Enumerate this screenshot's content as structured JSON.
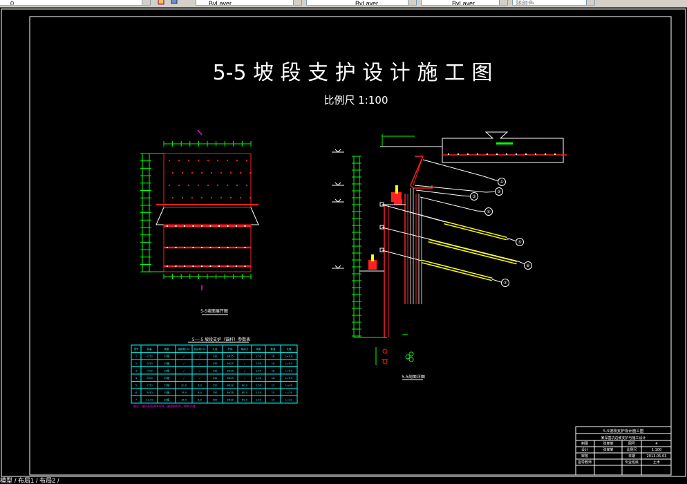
{
  "toolbar": {
    "layer_value": "0",
    "color_value": "ByLayer",
    "linetype_value": "ByLayer",
    "lineweight_value": "ByLayer",
    "plotstyle_value": "随颜色"
  },
  "drawing": {
    "title": "5-5 坡 段 支 护 设 计 施 工 图",
    "scale": "比例尺 1:100",
    "elevation_view_label": "5-5坡面展开图",
    "section_view_label": "5-5剖面详图",
    "table_title": "5----5 坡段支护（锚杆）参数表",
    "table_note": "备注：锚杆采用HRB400，锚固体M30，倾角15度。",
    "callouts": [
      "①",
      "②",
      "③",
      "④",
      "⑤",
      "⑥",
      "⑦"
    ],
    "anchor_table": {
      "headers": [
        "排号",
        "标高",
        "角度",
        "锚固段(m)",
        "自由段(m)",
        "孔径",
        "杆体",
        "轴向力",
        "间距",
        "数量",
        "长度"
      ],
      "rows": [
        [
          "1",
          "-2.50",
          "15度",
          "/",
          "/",
          "130",
          "3Φ25",
          "/",
          "1.50",
          "18",
          "L=9.0"
        ],
        [
          "2",
          "-3.50",
          "15度",
          "/",
          "/",
          "130",
          "3Φ25",
          "/",
          "1.50",
          "18",
          "L=9.0"
        ],
        [
          "3",
          "-4.00",
          "15度",
          "/",
          "/",
          "130",
          "3Φ25",
          "/",
          "1.50",
          "18",
          "L=9.0"
        ],
        [
          "4",
          "-5.00",
          "15度",
          "/",
          "/",
          "130",
          "3Φ25",
          "/",
          "1.50",
          "18",
          "L=9.0"
        ],
        [
          "5",
          "-7.50",
          "15度",
          "20.0",
          "6.0",
          "150",
          "3Φ28",
          "80.0",
          "1.50",
          "15",
          "L=26"
        ],
        [
          "6",
          "-9.50",
          "15度",
          "18.0",
          "6.0",
          "150",
          "3Φ28",
          "80.0",
          "1.50",
          "15",
          "L=24"
        ],
        [
          "7",
          "-11.50",
          "15度",
          "16.0",
          "6.0",
          "150",
          "3Φ28",
          "80.0",
          "1.50",
          "15",
          "L=22"
        ]
      ]
    },
    "title_block": {
      "drawing_name": "5-5坡段支护设计施工图",
      "project": "某深基坑边坡支护与施工设计",
      "rows": [
        {
          "label": "制图",
          "name": "张某某",
          "key": "图号",
          "value": "4"
        },
        {
          "label": "设计",
          "name": "张某某",
          "key": "比例尺",
          "value": "1:100"
        },
        {
          "label": "审核",
          "name": "",
          "key": "日期",
          "value": "2013.05.03"
        },
        {
          "label": "指导教师",
          "name": "",
          "key": "专业班级",
          "value": "土木"
        }
      ]
    }
  },
  "layout_tabs": [
    "模型",
    "布局1",
    "布局2"
  ],
  "colors": {
    "background": "#000000",
    "frame": "#ffffff",
    "dimension": "#00ff00",
    "structure": "#ff2020",
    "table": "#00ffff",
    "anchor_body": "#ffff00",
    "note": "#ff00ff"
  }
}
